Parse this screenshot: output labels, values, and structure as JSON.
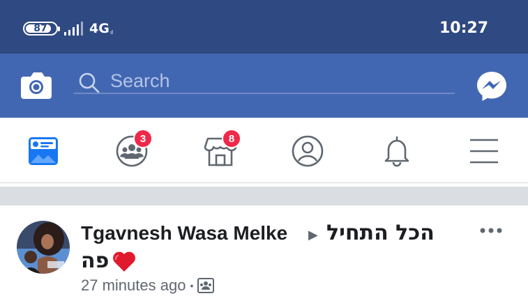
{
  "status_bar": {
    "battery": "87",
    "network": "4G",
    "network_sub": "ıl",
    "time": "10:27"
  },
  "header": {
    "search_placeholder": "Search",
    "icons": [
      "camera-icon",
      "search-icon",
      "messenger-icon"
    ]
  },
  "nav": {
    "items": [
      {
        "name": "news-feed",
        "icon": "news-feed-icon",
        "active": true,
        "badge": ""
      },
      {
        "name": "groups",
        "icon": "groups-icon",
        "active": false,
        "badge": "3"
      },
      {
        "name": "marketplace",
        "icon": "marketplace-icon",
        "active": false,
        "badge": "8"
      },
      {
        "name": "profile",
        "icon": "profile-icon",
        "active": false,
        "badge": ""
      },
      {
        "name": "notifications",
        "icon": "bell-icon",
        "active": false,
        "badge": ""
      },
      {
        "name": "menu",
        "icon": "hamburger-menu-icon",
        "active": false,
        "badge": ""
      }
    ]
  },
  "post": {
    "author": "Tgavnesh Wasa Melke",
    "group_line1": "הכל התחיל",
    "group_line2": "פה",
    "timestamp": "27 minutes ago",
    "audience_icon": "group-audience-icon"
  },
  "colors": {
    "status_bar": "#2f4982",
    "header": "#4267b2",
    "badge": "#f02849",
    "active_icon": "#1877f2",
    "heart": "#e0192d"
  }
}
